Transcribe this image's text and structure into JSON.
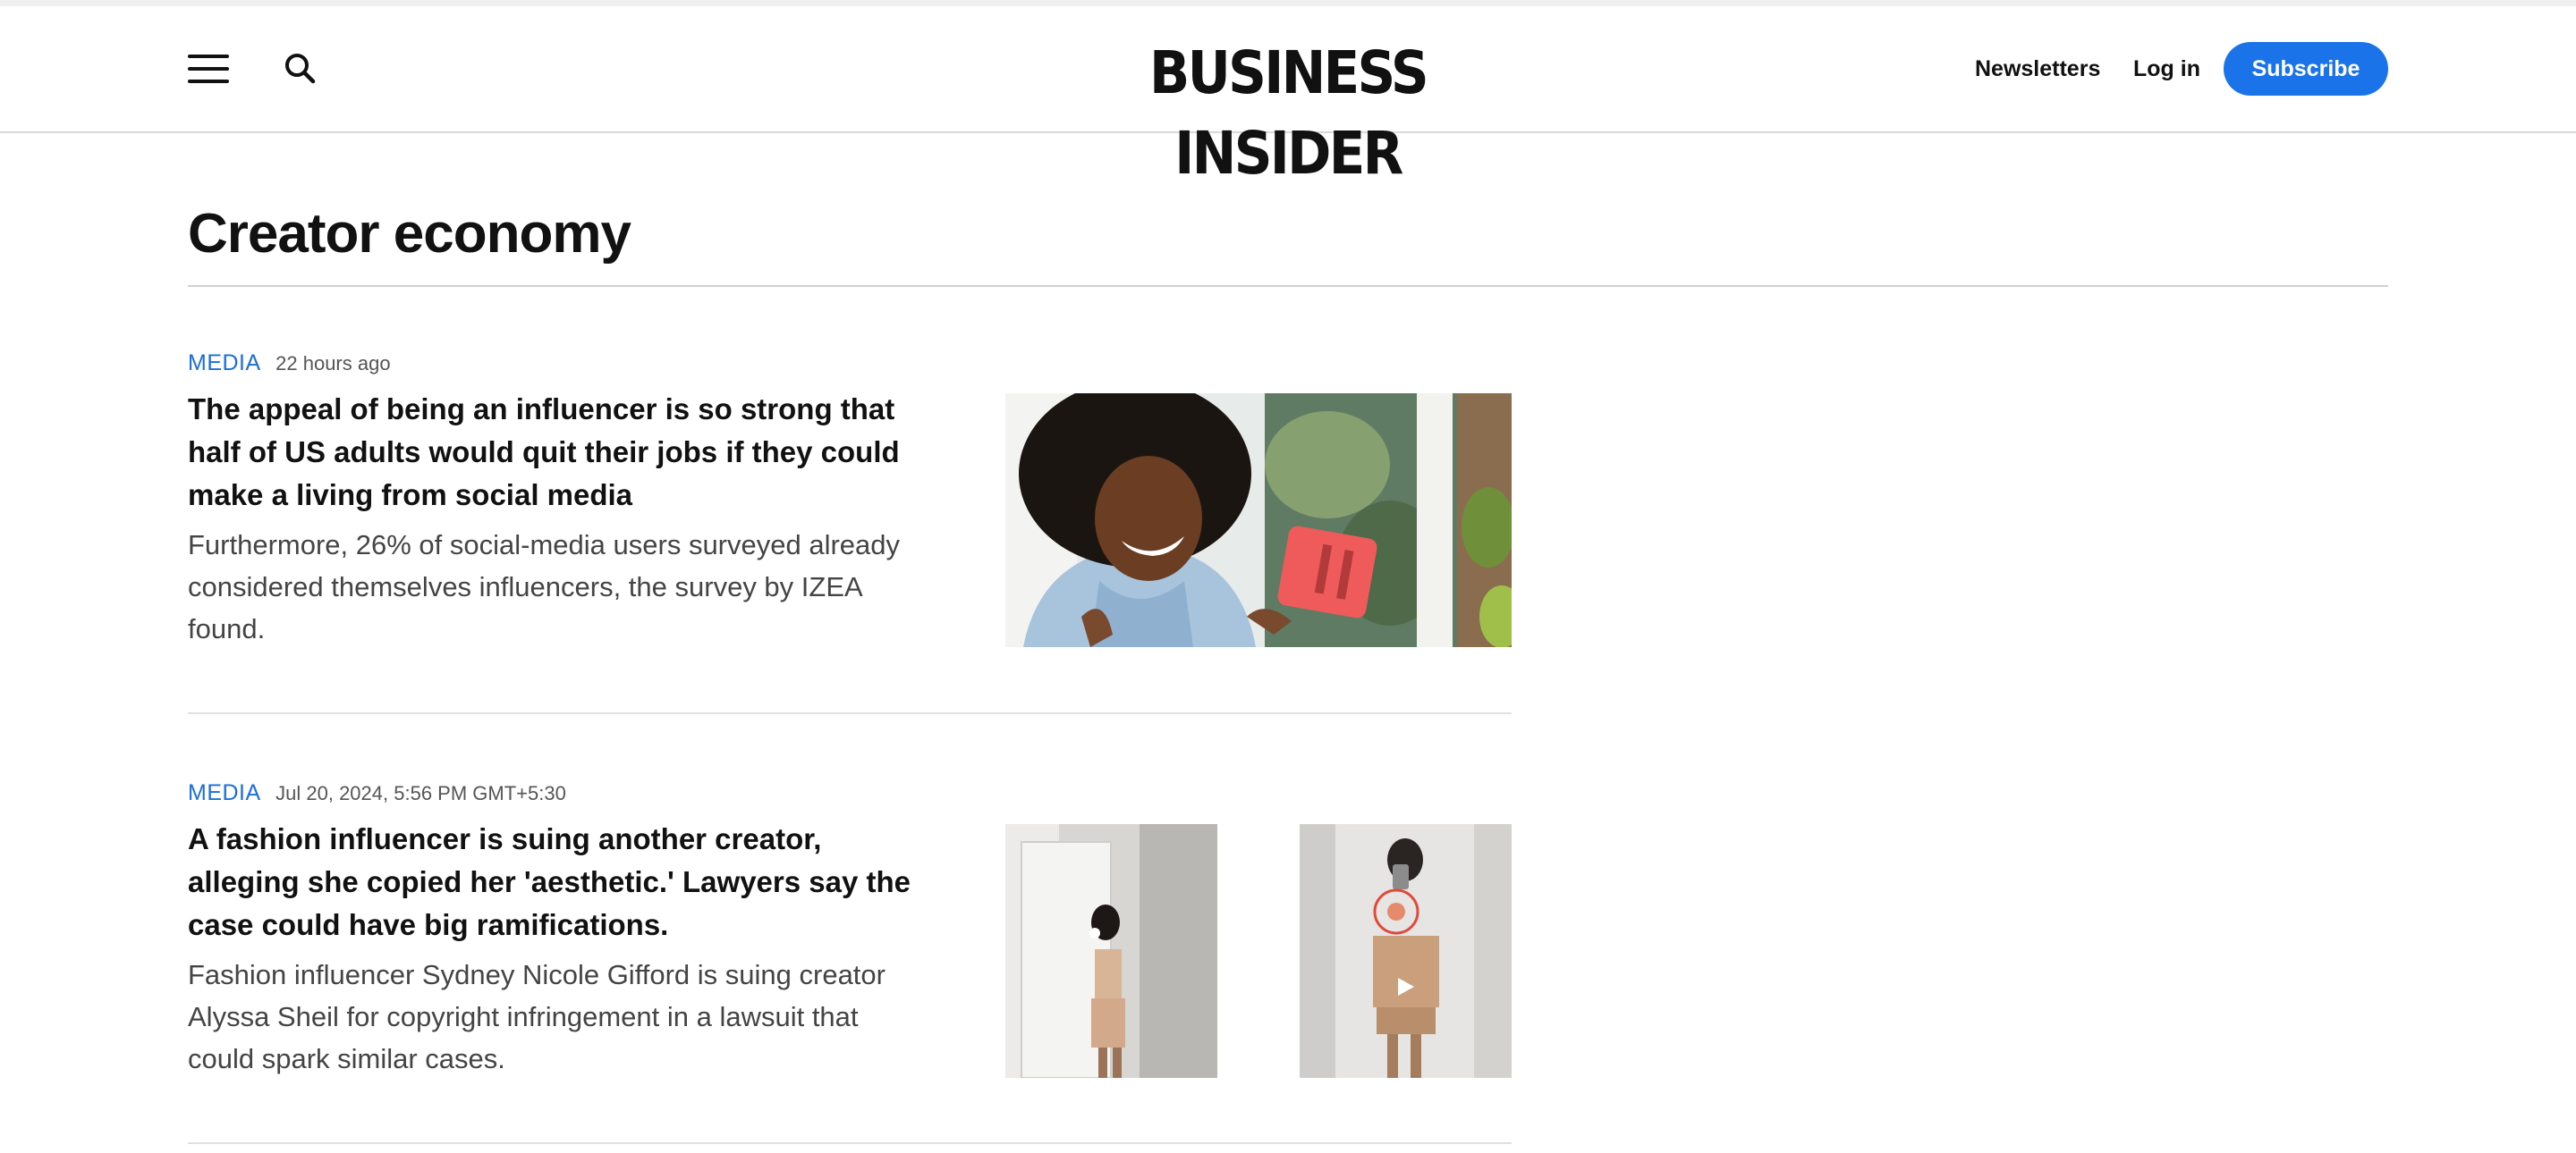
{
  "header": {
    "logo_text": "BUSINESS INSIDER",
    "newsletters_label": "Newsletters",
    "login_label": "Log in",
    "subscribe_label": "Subscribe",
    "menu_icon": "hamburger-menu-icon",
    "search_icon": "search-icon",
    "accent_color": "#1a73e8"
  },
  "page": {
    "title": "Creator economy"
  },
  "articles": [
    {
      "category": "MEDIA",
      "time": "22 hours ago",
      "headline": "The appeal of being an influencer is so strong that half of US adults would quit their jobs if they could make a living from social media",
      "dek": "Furthermore, 26% of social-media users surveyed already considered themselves influencers, the survey by IZEA found."
    },
    {
      "category": "MEDIA",
      "time": "Jul 20, 2024, 5:56 PM GMT+5:30",
      "headline": "A fashion influencer is suing another creator, alleging she copied her 'aesthetic.' Lawyers say the case could have big ramifications.",
      "dek": "Fashion influencer Sydney Nicole Gifford is suing creator Alyssa Sheil for copyright infringement in a lawsuit that could spark similar cases."
    }
  ]
}
